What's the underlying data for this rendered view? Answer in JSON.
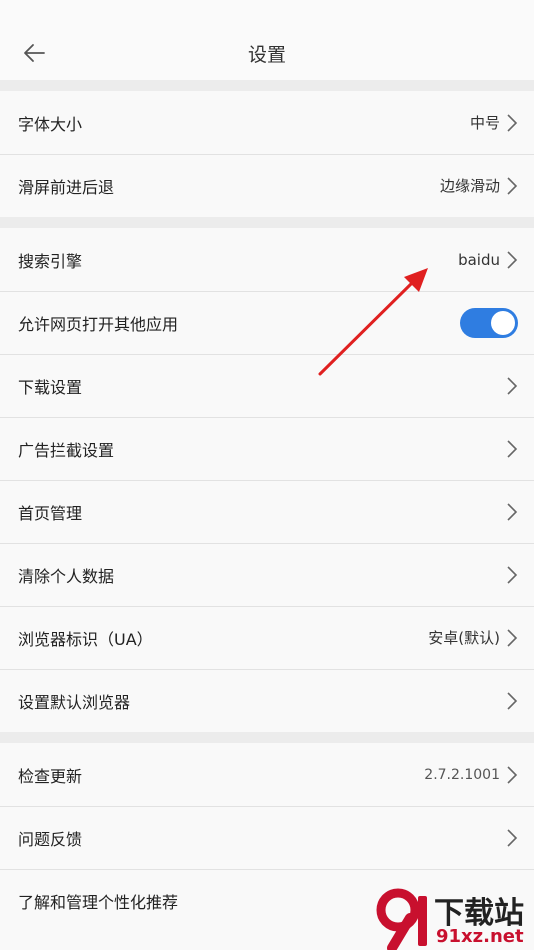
{
  "header": {
    "title": "设置"
  },
  "groups": [
    {
      "rows": [
        {
          "label": "字体大小",
          "value": "中号"
        },
        {
          "label": "滑屏前进后退",
          "value": "边缘滑动"
        }
      ]
    },
    {
      "rows": [
        {
          "label": "搜索引擎",
          "value": "baidu"
        },
        {
          "label": "允许网页打开其他应用",
          "toggle": true
        },
        {
          "label": "下载设置"
        },
        {
          "label": "广告拦截设置"
        },
        {
          "label": "首页管理"
        },
        {
          "label": "清除个人数据"
        },
        {
          "label": "浏览器标识（UA）",
          "value": "安卓(默认)"
        },
        {
          "label": "设置默认浏览器"
        }
      ]
    },
    {
      "rows": [
        {
          "label": "检查更新",
          "value": "2.7.2.1001"
        },
        {
          "label": "问题反馈"
        },
        {
          "label": "了解和管理个性化推荐"
        }
      ]
    }
  ],
  "watermark": {
    "brand": "下载站",
    "site": "91xz.net"
  },
  "colors": {
    "accent": "#2f7de1",
    "annotation": "#e02020",
    "watermark": "#c8102e"
  }
}
